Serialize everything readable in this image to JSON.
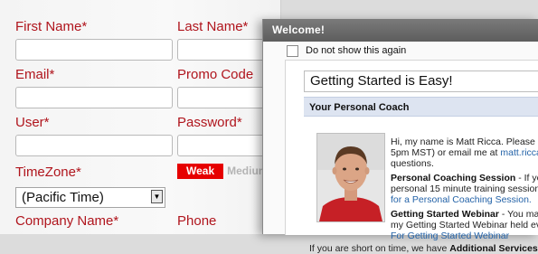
{
  "form": {
    "first_name_label": "First Name*",
    "last_name_label": "Last Name*",
    "email_label": "Email*",
    "promo_code_label": "Promo Code",
    "user_label": "User*",
    "password_label": "Password*",
    "timezone_label": "TimeZone*",
    "timezone_value": "(Pacific Time)",
    "password_strength": {
      "weak": "Weak",
      "medium": "Medium",
      "current": "Weak"
    },
    "company_name_label": "Company Name*",
    "phone_label": "Phone",
    "label_color": "#b0151d"
  },
  "dialog": {
    "title": "Welcome!",
    "dont_show_label": "Do not show this again",
    "heading": "Getting Started is Easy!",
    "coach_header": "Your Personal Coach",
    "intro_line1": "Hi, my name is Matt Ricca. Please ca",
    "intro_line2": "5pm MST) or email me at ",
    "intro_email": "matt.ricca",
    "intro_line3": "questions.",
    "coaching_title": "Personal Coaching Session",
    "coaching_rest": " - If you",
    "coaching_line2": "personal 15 minute training session",
    "coaching_link": "for a Personal Coaching Session.",
    "webinar_title": "Getting Started Webinar",
    "webinar_rest": " - You ma",
    "webinar_line2": "my Getting Started Webinar held ev",
    "webinar_link": "For Getting Started Webinar",
    "short_time_text": "If you are short on time, we have ",
    "short_time_bold": "Additional Services"
  }
}
